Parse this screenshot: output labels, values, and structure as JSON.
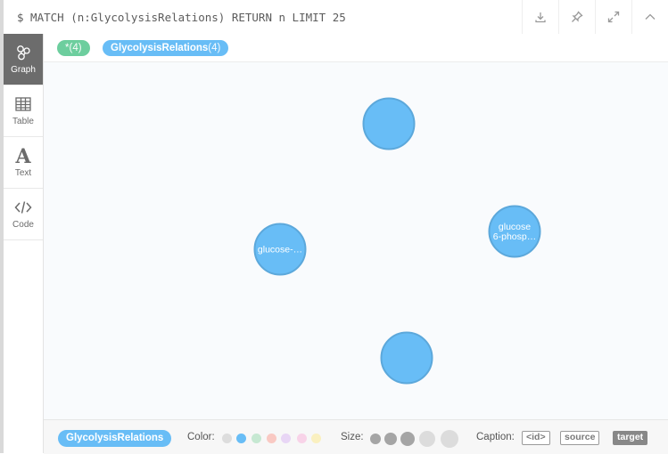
{
  "query": {
    "text": "$ MATCH (n:GlycolysisRelations) RETURN n LIMIT 25"
  },
  "toolbar": {
    "icons": [
      "download-icon",
      "pin-icon",
      "expand-icon",
      "collapse-icon"
    ]
  },
  "sidebar": {
    "items": [
      {
        "label": "Graph",
        "icon": "graph-icon",
        "active": true
      },
      {
        "label": "Table",
        "icon": "table-icon",
        "active": false
      },
      {
        "label": "Text",
        "icon": "text-icon",
        "active": false
      },
      {
        "label": "Code",
        "icon": "code-icon",
        "active": false
      }
    ]
  },
  "labels": {
    "all": {
      "name": "*",
      "count": "(4)"
    },
    "label": {
      "name": "GlycolysisRelations",
      "count": "(4)"
    }
  },
  "graph": {
    "node_color": "#68bdf6",
    "node_border": "#5ca8db",
    "nodes": [
      {
        "caption_lines": []
      },
      {
        "caption_lines": [
          "glucose-…"
        ]
      },
      {
        "caption_lines": [
          "glucose",
          "6-phosp…"
        ]
      },
      {
        "caption_lines": []
      }
    ]
  },
  "footer": {
    "label_name": "GlycolysisRelations",
    "color_label": "Color:",
    "size_label": "Size:",
    "caption_label": "Caption:",
    "colors": [
      "#dddddd",
      "#68bdf6",
      "#c6e8d2",
      "#f9c9c3",
      "#e8d6f5",
      "#f8d3e8",
      "#faf0c0"
    ],
    "caption_options": [
      "<id>",
      "source",
      "target"
    ],
    "caption_selected": "target"
  }
}
